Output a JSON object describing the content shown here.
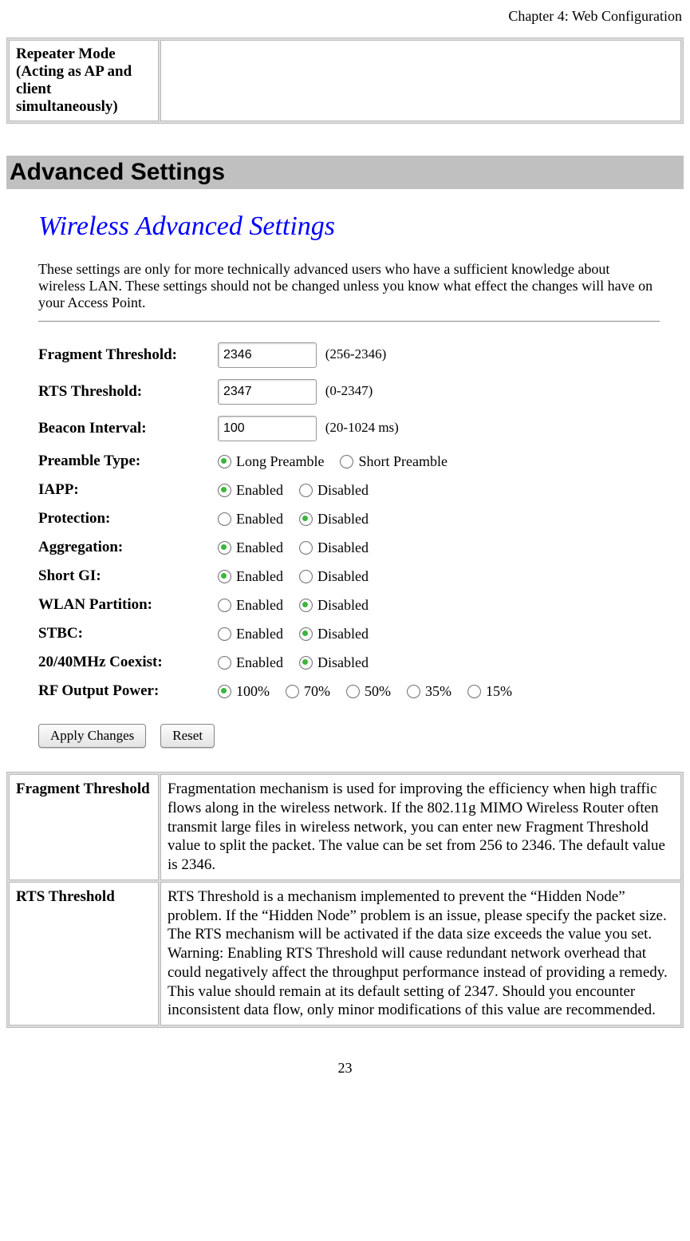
{
  "header": {
    "chapter": "Chapter 4: Web Configuration"
  },
  "topbox": {
    "label": "Repeater Mode (Acting as AP and client simultaneously)"
  },
  "section_title": "Advanced Settings",
  "config": {
    "title": "Wireless Advanced Settings",
    "description": "These settings are only for more technically advanced users who have a sufficient knowledge about wireless LAN. These settings should not be changed unless you know what effect the changes will have on your Access Point."
  },
  "fields": {
    "fragment": {
      "label": "Fragment Threshold:",
      "value": "2346",
      "hint": "(256-2346)"
    },
    "rts": {
      "label": "RTS Threshold:",
      "value": "2347",
      "hint": "(0-2347)"
    },
    "beacon": {
      "label": "Beacon Interval:",
      "value": "100",
      "hint": "(20-1024 ms)"
    },
    "preamble": {
      "label": "Preamble Type:",
      "opt1": "Long Preamble",
      "opt2": "Short Preamble",
      "selected": "opt1"
    },
    "iapp": {
      "label": "IAPP:",
      "opt1": "Enabled",
      "opt2": "Disabled",
      "selected": "opt1"
    },
    "protection": {
      "label": "Protection:",
      "opt1": "Enabled",
      "opt2": "Disabled",
      "selected": "opt2"
    },
    "aggregation": {
      "label": "Aggregation:",
      "opt1": "Enabled",
      "opt2": "Disabled",
      "selected": "opt1"
    },
    "shortgi": {
      "label": "Short GI:",
      "opt1": "Enabled",
      "opt2": "Disabled",
      "selected": "opt1"
    },
    "wlan": {
      "label": "WLAN Partition:",
      "opt1": "Enabled",
      "opt2": "Disabled",
      "selected": "opt2"
    },
    "stbc": {
      "label": "STBC:",
      "opt1": "Enabled",
      "opt2": "Disabled",
      "selected": "opt2"
    },
    "coexist": {
      "label": "20/40MHz Coexist:",
      "opt1": "Enabled",
      "opt2": "Disabled",
      "selected": "opt2"
    },
    "rfpower": {
      "label": "RF Output Power:",
      "opts": [
        "100%",
        "70%",
        "50%",
        "35%",
        "15%"
      ],
      "selected": 0
    }
  },
  "buttons": {
    "apply": "Apply Changes",
    "reset": "Reset"
  },
  "desc": {
    "rows": [
      {
        "term": "Fragment Threshold",
        "text": "Fragmentation mechanism is used for improving the efficiency when high traffic flows along in the wireless network. If the 802.11g MIMO Wireless Router often transmit large files in wireless network, you can enter new Fragment Threshold value to split the packet.  The value can be set from 256 to 2346. The default value is 2346."
      },
      {
        "term": "RTS Threshold",
        "text": "RTS Threshold is a mechanism implemented to prevent the “Hidden Node” problem. If the “Hidden Node” problem is an issue, please specify the packet size. The RTS mechanism will be activated if the data size exceeds the value you set.\nWarning: Enabling RTS Threshold will cause redundant network overhead that could negatively affect the throughput performance instead of providing a remedy.\nThis value should remain at its default setting of 2347. Should you encounter inconsistent data flow, only minor modifications of this value are recommended."
      }
    ]
  },
  "page_number": "23"
}
